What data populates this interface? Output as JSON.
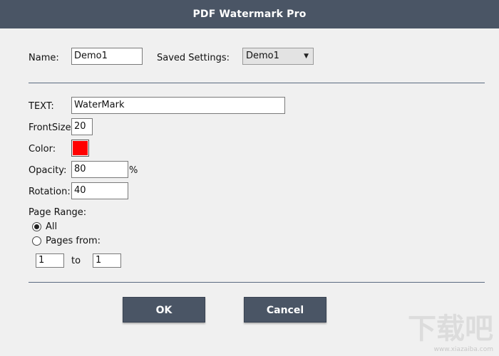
{
  "window": {
    "title": "PDF Watermark Pro"
  },
  "settings": {
    "name_label": "Name:",
    "name_value": "Demo1",
    "saved_label": "Saved Settings:",
    "saved_value": "Demo1"
  },
  "watermark": {
    "text_label": "TEXT:",
    "text_value": "WaterMark",
    "fontsize_label": "FrontSize",
    "fontsize_value": "20",
    "color_label": "Color:",
    "color_value": "#ff0000",
    "opacity_label": "Opacity:",
    "opacity_value": "80",
    "opacity_unit": "%",
    "rotation_label": "Rotation:",
    "rotation_value": "40"
  },
  "page_range": {
    "label": "Page Range:",
    "all_label": "All",
    "all_selected": true,
    "pages_label": "Pages from:",
    "from_value": "1",
    "to_label": "to",
    "to_value": "1"
  },
  "buttons": {
    "ok": "OK",
    "cancel": "Cancel"
  },
  "site_watermark": {
    "big": "下载吧",
    "small": "www.xiazaiba.com"
  }
}
